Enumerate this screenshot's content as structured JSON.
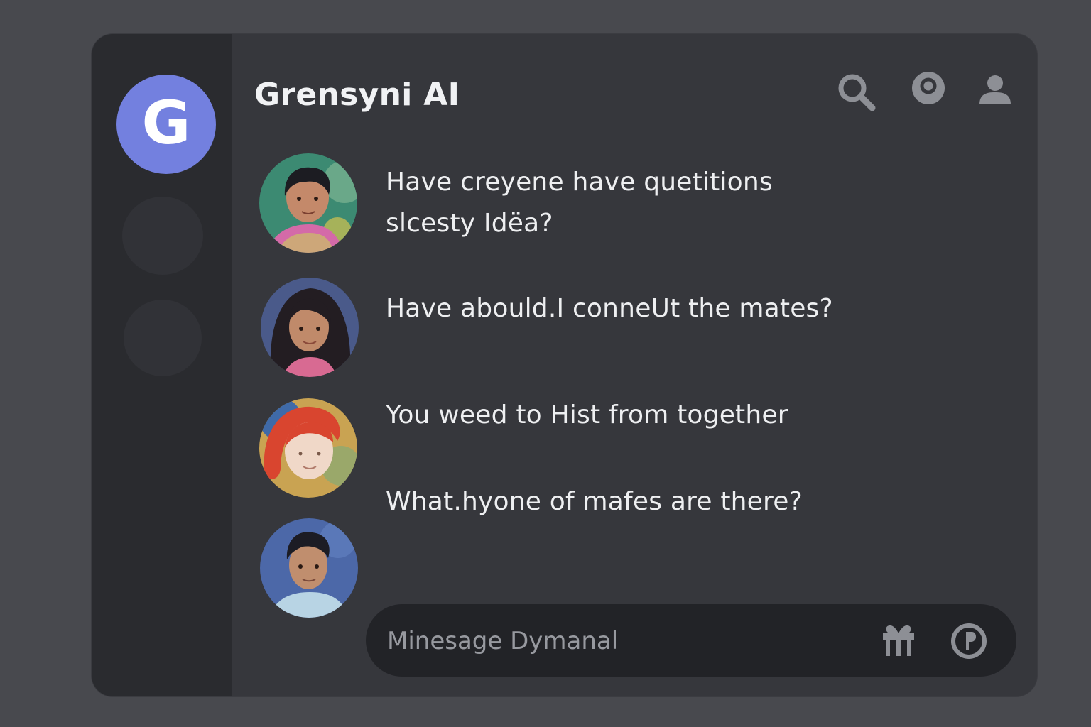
{
  "window": {
    "title": "Grensyni AI"
  },
  "servers": {
    "items": [
      {
        "glyph": "G",
        "color": "#7380df",
        "icon": "server-g-icon"
      },
      {
        "glyph": "",
        "color": "#313237",
        "icon": "server-placeholder"
      },
      {
        "glyph": "",
        "color": "#313237",
        "icon": "server-placeholder"
      }
    ]
  },
  "header": {
    "icons": [
      "search-icon",
      "target-icon",
      "user-icon"
    ]
  },
  "messages": [
    {
      "avatar": "avatar-teal-boy",
      "lines": [
        "Have creyene have quetitions",
        "slcesty Idëa?"
      ]
    },
    {
      "avatar": "avatar-dark-hair-woman",
      "lines": [
        "Have abould.I conneUt the mates?"
      ]
    },
    {
      "avatar": "avatar-red-hair",
      "lines": [
        "You weed to Hist from together"
      ]
    },
    {
      "avatar": "avatar-blue-boy",
      "lines": [
        "What.hyone of mafes are there?"
      ]
    }
  ],
  "composer": {
    "placeholder": "Minesage Dymanal",
    "value": "",
    "icons": [
      "gift-icon",
      "sticker-icon"
    ]
  },
  "colors": {
    "background": "#48494e",
    "window": "#36373c",
    "rail": "#2a2b2f",
    "accent": "#7380df",
    "composer": "#222327"
  }
}
